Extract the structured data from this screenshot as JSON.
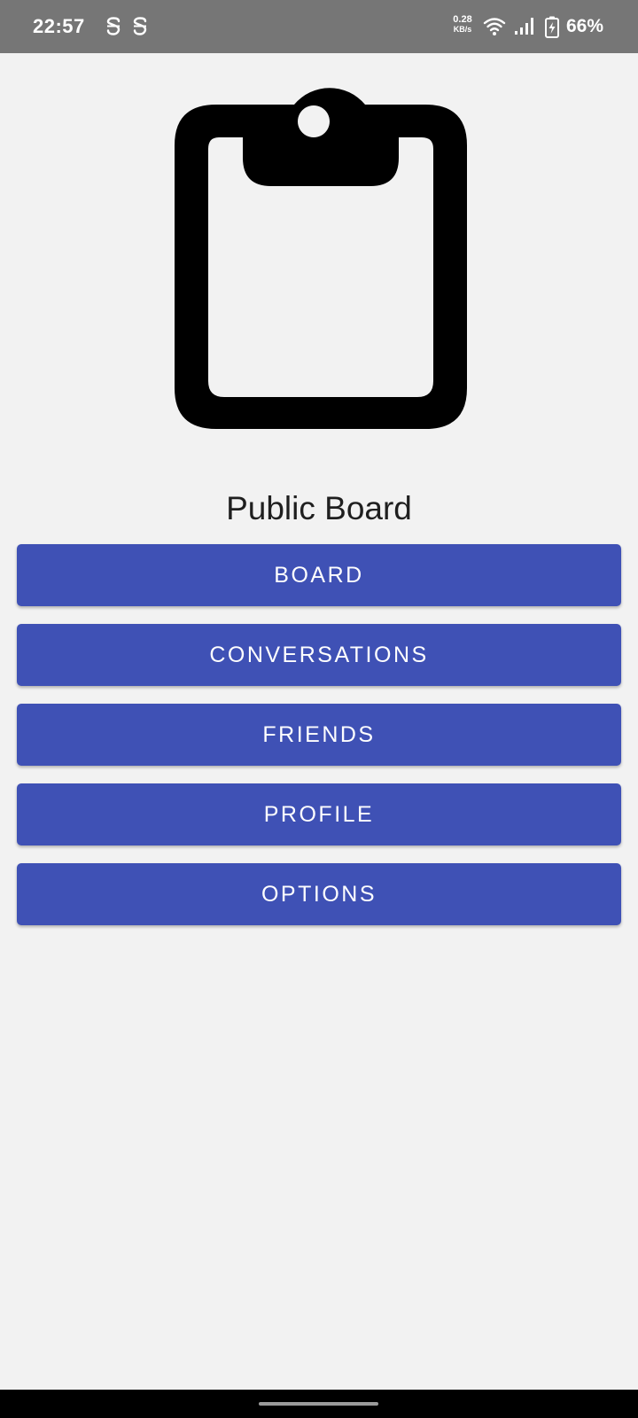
{
  "status_bar": {
    "time": "22:57",
    "net_speed_value": "0.28",
    "net_speed_unit": "KB/s",
    "battery": "66%",
    "icons": [
      "notification-app-icon",
      "notification-app-icon",
      "wifi-icon",
      "cell-signal-icon",
      "battery-charging-icon"
    ]
  },
  "app": {
    "hero_icon": "clipboard-icon",
    "title": "Public Board"
  },
  "menu": {
    "items": [
      {
        "label": "BOARD"
      },
      {
        "label": "CONVERSATIONS"
      },
      {
        "label": "FRIENDS"
      },
      {
        "label": "PROFILE"
      },
      {
        "label": "OPTIONS"
      }
    ]
  },
  "colors": {
    "status_bar_bg": "#767676",
    "background": "#f2f2f2",
    "button_bg": "#3f51b5",
    "button_text": "#ffffff",
    "title_text": "#1f1f1f"
  }
}
